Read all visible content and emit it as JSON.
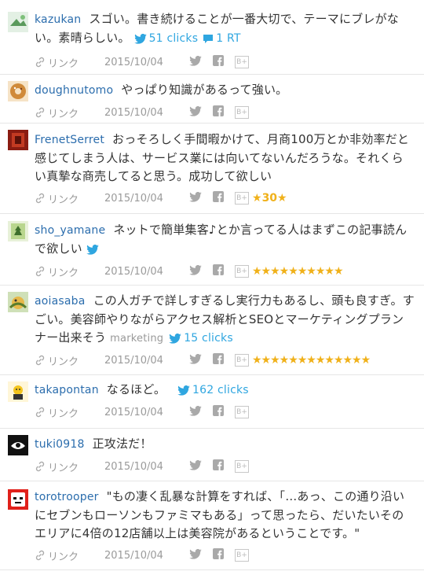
{
  "labels": {
    "link": "リンク",
    "date": "2015/10/04",
    "hatebu_icon": "B+"
  },
  "entries": [
    {
      "user": "kazukan",
      "comment": "スゴい。書き続けることが一番大切で、テーマにブレがない。素晴らしい。",
      "clicks": "51 clicks",
      "rt": "1 RT"
    },
    {
      "user": "doughnutomo",
      "comment": "やっぱり知識があるって強い。"
    },
    {
      "user": "FrenetSerret",
      "comment": "おっそろしく手間暇かけて、月商100万とか非効率だと感じてしまう人は、サービス業には向いてないんだろうな。それくらい真摯な商売してると思う。成功して欲しい",
      "star_count": "30"
    },
    {
      "user": "sho_yamane",
      "comment": "ネットで簡単集客♪とか言ってる人はまずこの記事読んで欲しい",
      "stars": "★★★★★★★★★★"
    },
    {
      "user": "aoiasaba",
      "comment": "この人ガチで詳しすぎるし実行力もあるし、頭も良すぎ。すごい。美容師やりながらアクセス解析とSEOとマーケティングプランナー出来そう",
      "tag": "marketing",
      "clicks": "15 clicks",
      "stars": "★★★★★★★★★★★★★"
    },
    {
      "user": "takapontan",
      "comment": "なるほど。",
      "clicks": "162 clicks"
    },
    {
      "user": "tuki0918",
      "comment": "正攻法だ！"
    },
    {
      "user": "torotrooper",
      "comment": "\"もの凄く乱暴な計算をすれば、「…あっ、この通り沿いにセブンもローソンもファミマもある」って思ったら、だいたいそのエリアに4倍の12店舗以上は美容院があるということです。\""
    }
  ],
  "colors": {
    "username": "#2b6dad",
    "twitter": "#2fa6e0",
    "star": "#f0b11a",
    "meta": "#9a9a9a"
  }
}
